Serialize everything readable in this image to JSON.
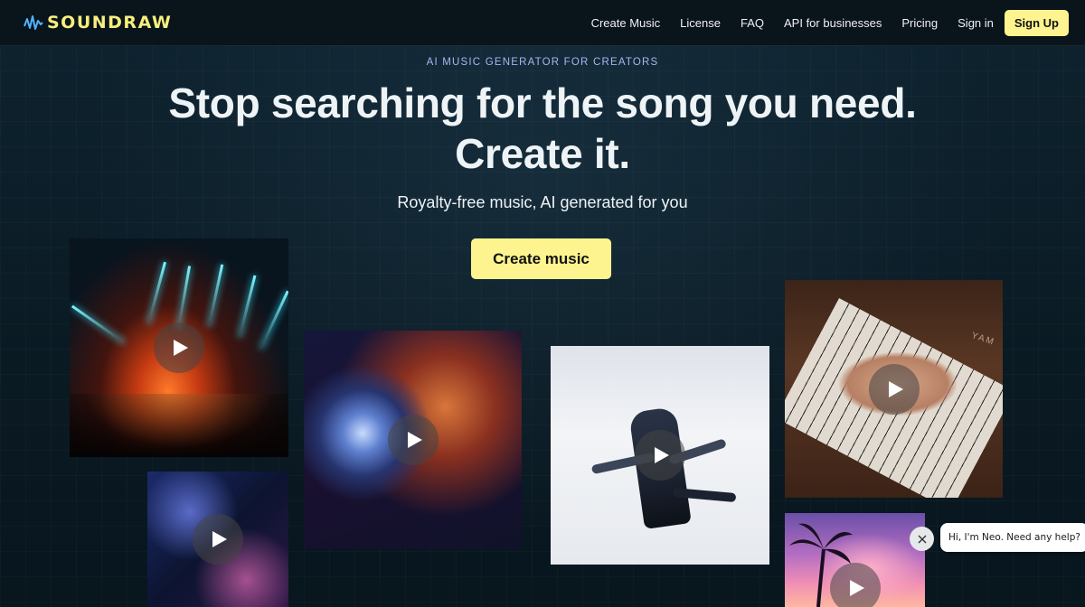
{
  "nav": {
    "logo_text": "SOUNDRAW",
    "links": [
      "Create Music",
      "License",
      "FAQ",
      "API for businesses",
      "Pricing",
      "Sign in"
    ],
    "signup_label": "Sign Up"
  },
  "hero": {
    "eyebrow": "AI MUSIC GENERATOR FOR CREATORS",
    "headline_line1": "Stop searching for the song you need.",
    "headline_line2": "Create it.",
    "subhead": "Royalty-free music, AI generated for you",
    "cta_label": "Create music"
  },
  "tiles": [
    {
      "subject": "concert-lights"
    },
    {
      "subject": "city-night"
    },
    {
      "subject": "disco-ball-person"
    },
    {
      "subject": "dancer"
    },
    {
      "subject": "piano-hands",
      "brand_text": "YAM"
    },
    {
      "subject": "palm-sunset"
    }
  ],
  "chat": {
    "message": "Hi, I'm Neo. Need any help?"
  },
  "colors": {
    "accent": "#fdf48f",
    "logo": "#f7ef7e",
    "background": "#0b1a24",
    "eyebrow": "#a7b6f0"
  }
}
